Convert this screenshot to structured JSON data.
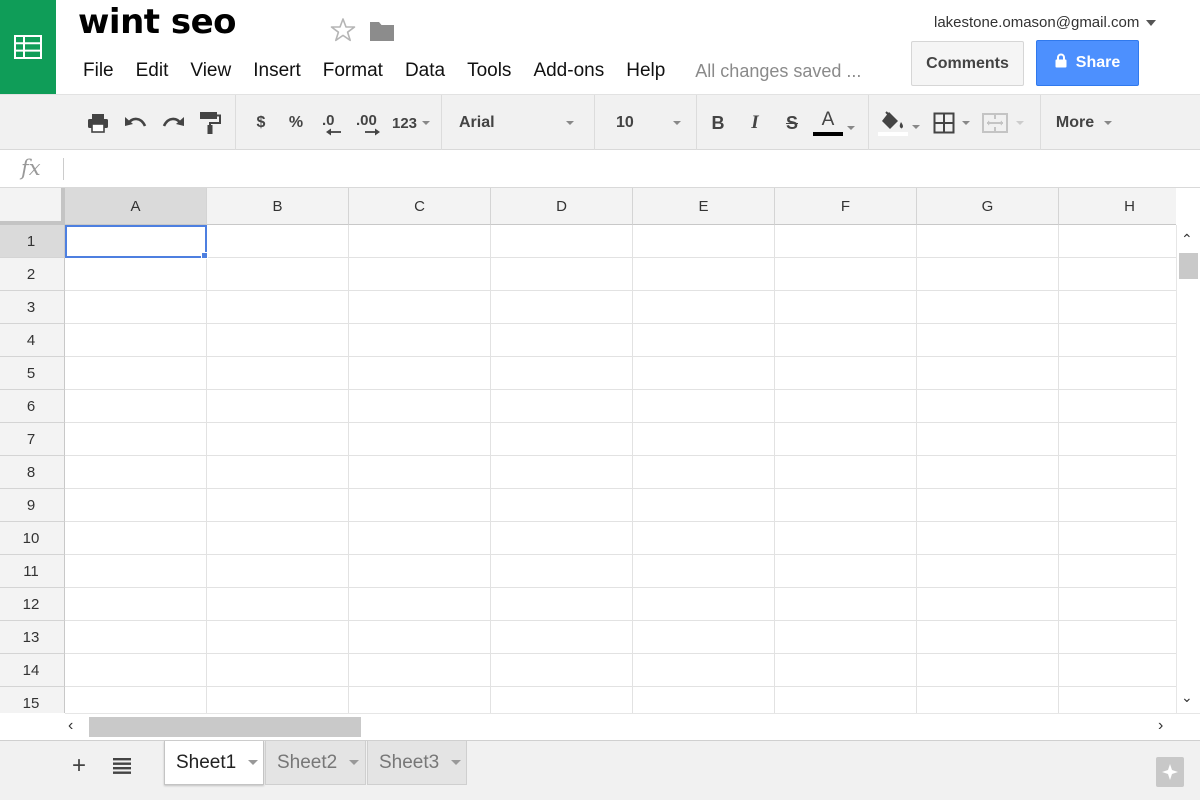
{
  "document": {
    "title": "wint seo",
    "save_status": "All changes saved ..."
  },
  "account": {
    "email": "lakestone.omason@gmail.com"
  },
  "menu": {
    "items": [
      "File",
      "Edit",
      "View",
      "Insert",
      "Format",
      "Data",
      "Tools",
      "Add-ons",
      "Help"
    ]
  },
  "buttons": {
    "comments": "Comments",
    "share": "Share"
  },
  "toolbar": {
    "currency": "$",
    "percent": "%",
    "decrease_decimal": ".0",
    "increase_decimal": ".00",
    "more_formats": "123",
    "font_family": "Arial",
    "font_size": "10",
    "bold": "B",
    "italic": "I",
    "strikethrough": "S",
    "text_color": "A",
    "more": "More",
    "icons": [
      "print-icon",
      "undo-icon",
      "redo-icon",
      "paint-format-icon",
      "fill-color-icon",
      "borders-icon",
      "merge-cells-icon"
    ]
  },
  "formula_bar": {
    "label": "fx",
    "value": ""
  },
  "grid": {
    "columns": [
      "A",
      "B",
      "C",
      "D",
      "E",
      "F",
      "G",
      "H"
    ],
    "rows": [
      "1",
      "2",
      "3",
      "4",
      "5",
      "6",
      "7",
      "8",
      "9",
      "10",
      "11",
      "12",
      "13",
      "14",
      "15"
    ],
    "active_cell": "A1"
  },
  "sheets": {
    "tabs": [
      "Sheet1",
      "Sheet2",
      "Sheet3"
    ],
    "active": "Sheet1"
  },
  "colors": {
    "brand_green": "#0f9d58",
    "share_blue": "#4d90fe",
    "selection_blue": "#4d7fe0"
  }
}
